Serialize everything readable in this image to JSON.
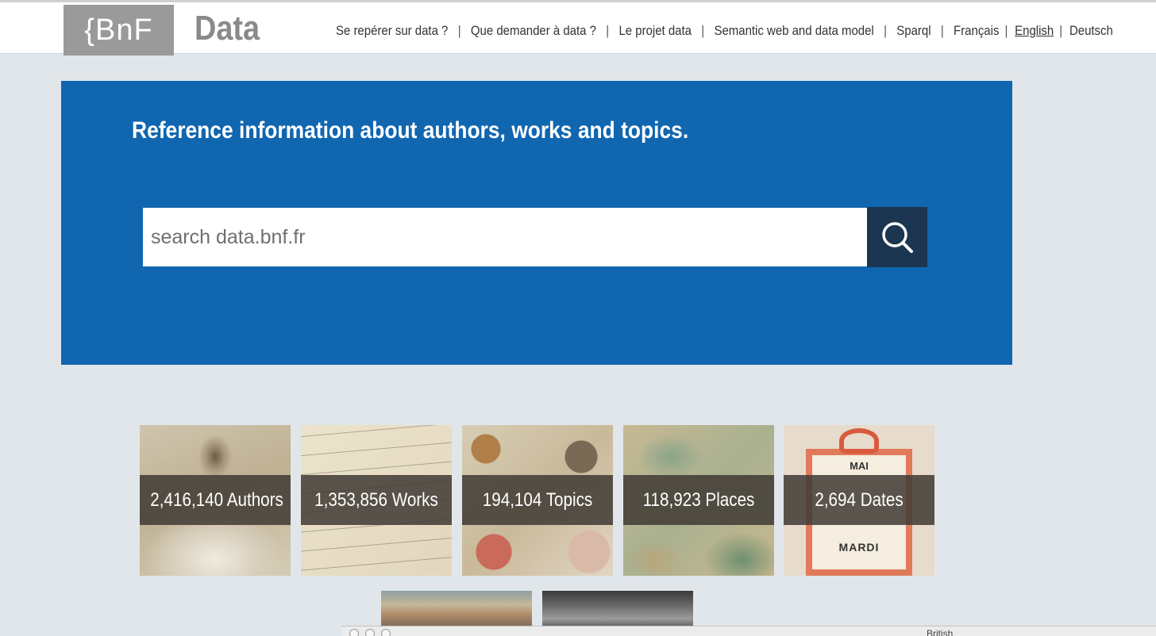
{
  "header": {
    "logo_text": "{BnF",
    "logo_data": "Data",
    "nav": [
      {
        "label": "Se repérer sur data ?"
      },
      {
        "label": "Que demander à data ?"
      },
      {
        "label": "Le projet data"
      },
      {
        "label": "Semantic web and data model"
      },
      {
        "label": "Sparql"
      },
      {
        "label": "Français"
      },
      {
        "label": "English",
        "active": true
      },
      {
        "label": "Deutsch"
      }
    ],
    "separator": "|"
  },
  "hero": {
    "title": "Reference information about authors, works and topics.",
    "search_placeholder": "search data.bnf.fr"
  },
  "tiles": [
    {
      "label": "2,416,140 Authors"
    },
    {
      "label": "1,353,856 Works"
    },
    {
      "label": "194,104 Topics"
    },
    {
      "label": "118,923 Places"
    },
    {
      "label": "2,694 Dates"
    }
  ],
  "dates_card": {
    "top_text": "MAI",
    "bottom_text": "MARDI"
  },
  "popup": {
    "text": "British"
  },
  "colors": {
    "hero_bg": "#1166b0",
    "search_button_bg": "#1c3550",
    "page_bg": "#e1e6ea",
    "logo_bg": "#9a9a9a"
  }
}
